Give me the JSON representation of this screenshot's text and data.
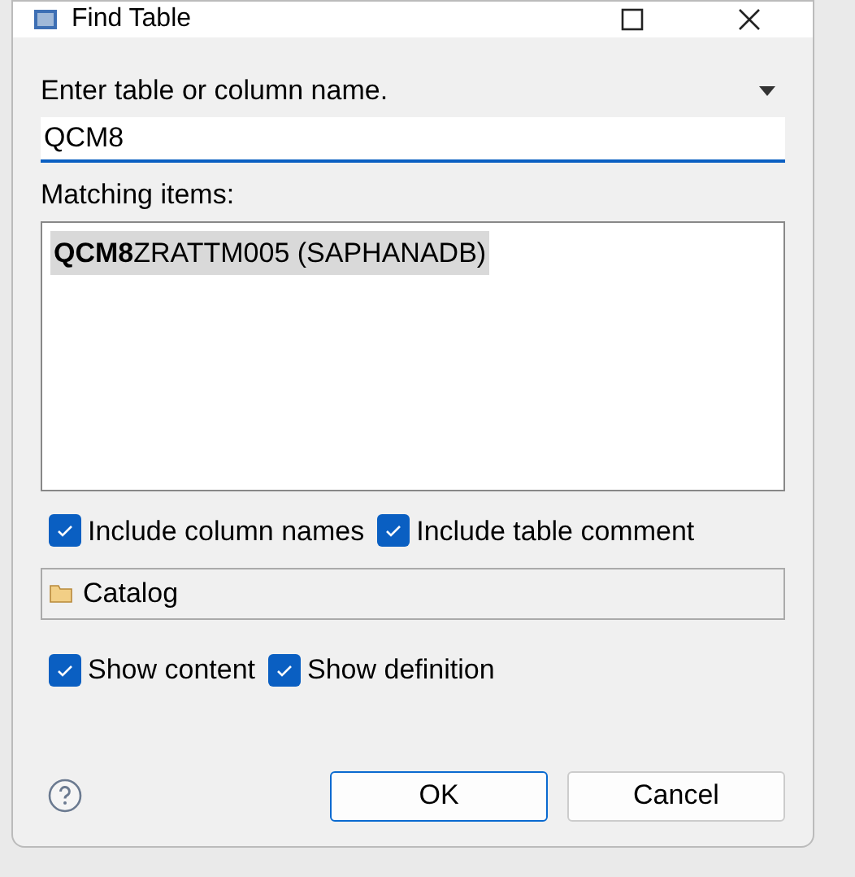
{
  "window": {
    "title": "Find Table"
  },
  "search": {
    "label": "Enter table or column name.",
    "value": "QCM8"
  },
  "matching": {
    "label": "Matching items:",
    "items": [
      {
        "text": "**QCM8**ZRATTM005 (SAPHANADB)",
        "selected": true
      }
    ]
  },
  "options": [
    {
      "label": "Include column names",
      "checked": true
    },
    {
      "label": "Include table comment",
      "checked": true
    }
  ],
  "catalog": {
    "label": "Catalog"
  },
  "show_options": [
    {
      "label": "Show content",
      "checked": true
    },
    {
      "label": "Show definition",
      "checked": true
    }
  ],
  "buttons": [
    {
      "label": "OK",
      "default": true
    },
    {
      "label": "Cancel",
      "default": false
    }
  ]
}
